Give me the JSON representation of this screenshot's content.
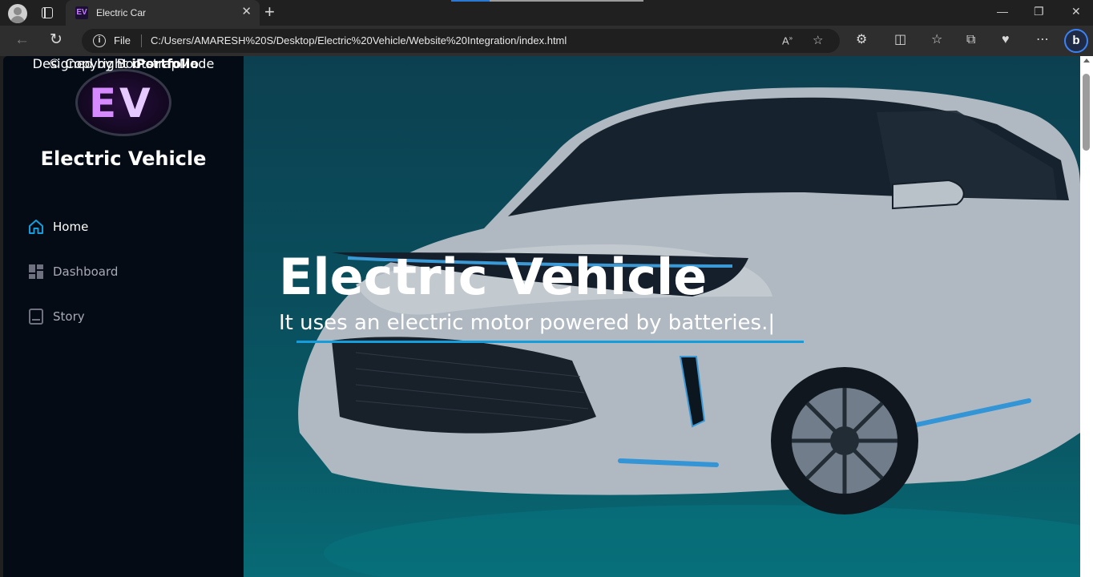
{
  "browser": {
    "tab_title": "Electric Car",
    "tab_favicon": "EV",
    "tab_close": "✕",
    "new_tab": "+",
    "file_label": "File",
    "url": "C:/Users/AMARESH%20S/Desktop/Electric%20Vehicle/Website%20Integration/index.html",
    "bing_label": "b",
    "window_controls": {
      "minimize": "—",
      "restore": "❐",
      "close": "✕"
    }
  },
  "sidebar": {
    "logo_letters": {
      "e": "E",
      "v": "V"
    },
    "brand_title": "Electric Vehicle",
    "nav": [
      {
        "label": "Home",
        "icon": "home-icon",
        "active": true
      },
      {
        "label": "Dashboard",
        "icon": "dashboard-icon",
        "active": false
      },
      {
        "label": "Story",
        "icon": "book-icon",
        "active": false
      }
    ],
    "footer": {
      "copyright_prefix": "© Copyright ",
      "copyright_brand": "iPortfolio",
      "designed_prefix": "Designed by ",
      "designed_link": "BootstrapMade"
    }
  },
  "hero": {
    "title": "Electric Vehicle",
    "subtitle": "It uses an electric motor powered by batteries.|"
  },
  "colors": {
    "accent": "#149ddd",
    "sidebar_bg": "#040b14",
    "link": "#2a8bd6"
  }
}
